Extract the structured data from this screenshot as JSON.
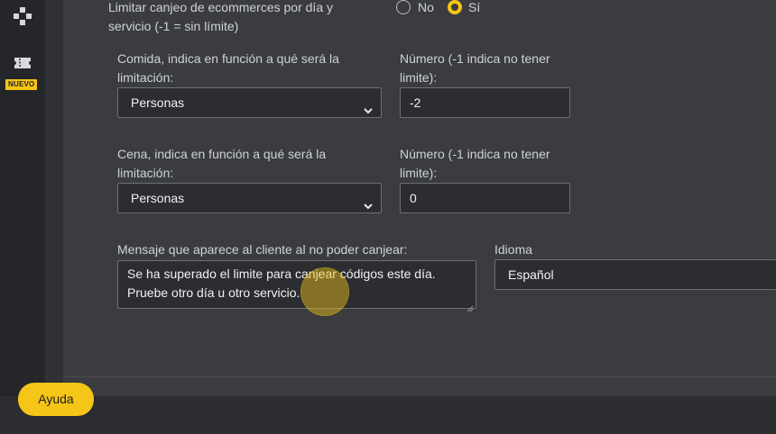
{
  "sidebar": {
    "items": [
      {
        "icon": "gamepad-icon"
      },
      {
        "icon": "ticket-icon",
        "badge": "NUEVO"
      }
    ]
  },
  "form": {
    "limit_question": {
      "label_line1": "Limitar canjeo de ecommerces por día y",
      "label_line2": "servicio (-1 = sin límite)",
      "options": [
        {
          "label": "No",
          "selected": false
        },
        {
          "label": "Sí",
          "selected": true
        }
      ]
    },
    "comida": {
      "select_label_line1": "Comida, indica en función a qué será la",
      "select_label_line2": "limitación:",
      "select_value": "Personas",
      "number_label_line1": "Número (-1 indica no tener",
      "number_label_line2": "limite):",
      "number_value": "-2"
    },
    "cena": {
      "select_label_line1": "Cena, indica en función a qué será la",
      "select_label_line2": "limitación:",
      "select_value": "Personas",
      "number_label_line1": "Número (-1 indica no tener",
      "number_label_line2": "limite):",
      "number_value": "0"
    },
    "message": {
      "label": "Mensaje que aparece al cliente al no poder canjear:",
      "line1": "Se ha superado el limite para canjear códigos este día.",
      "line2": "Pruebe otro día u otro servicio."
    },
    "language": {
      "label": "Idioma",
      "value": "Español"
    }
  },
  "help_button": {
    "label": "Ayuda"
  },
  "colors": {
    "accent": "#f5c518",
    "panel": "#3a3c3f",
    "background": "#2b2d30"
  }
}
